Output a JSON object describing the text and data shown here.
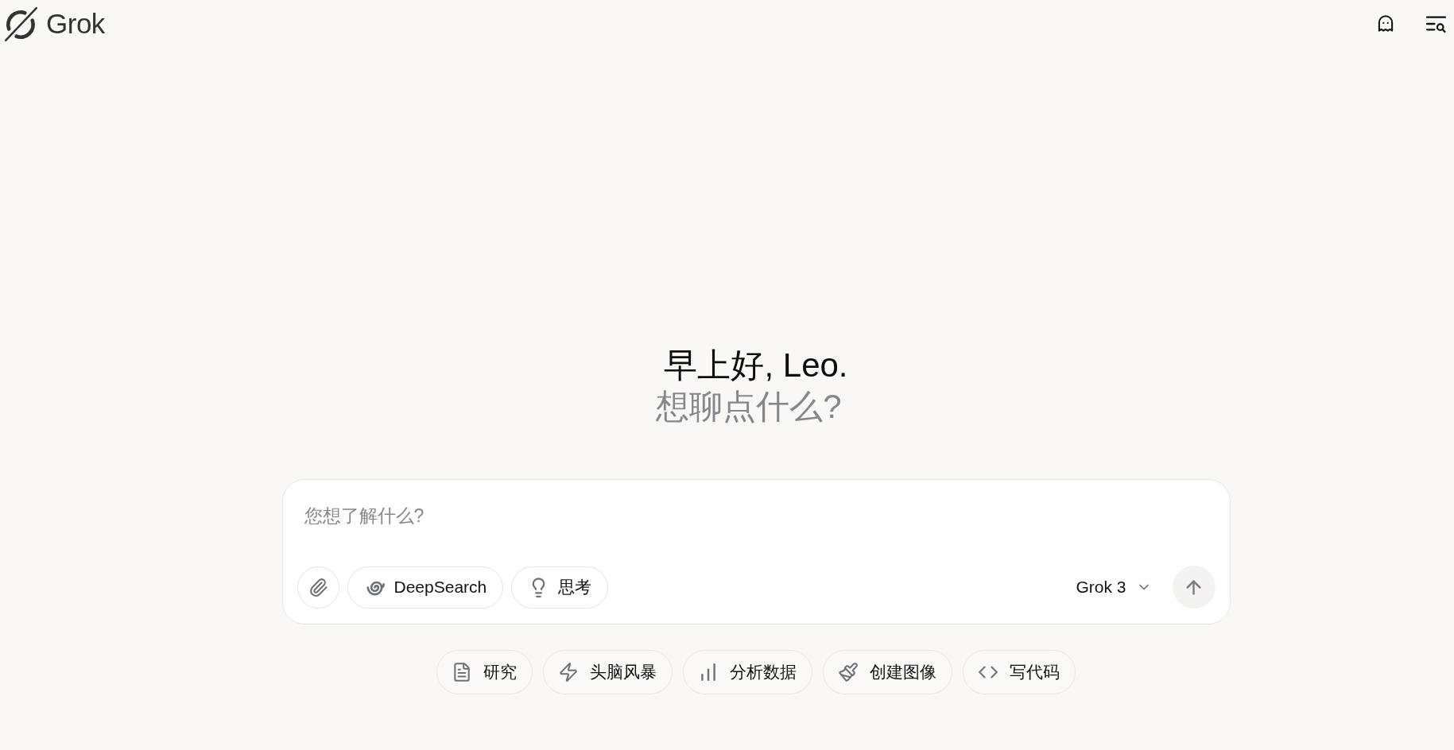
{
  "header": {
    "logo_text": "Grok"
  },
  "greeting": {
    "title": "早上好, Leo.",
    "subtitle": "想聊点什么?"
  },
  "composer": {
    "placeholder": "您想了解什么?",
    "tools": [
      {
        "label": "DeepSearch"
      },
      {
        "label": "思考"
      }
    ],
    "model": "Grok 3"
  },
  "suggestions": [
    {
      "label": "研究"
    },
    {
      "label": "头脑风暴"
    },
    {
      "label": "分析数据"
    },
    {
      "label": "创建图像"
    },
    {
      "label": "写代码"
    }
  ]
}
